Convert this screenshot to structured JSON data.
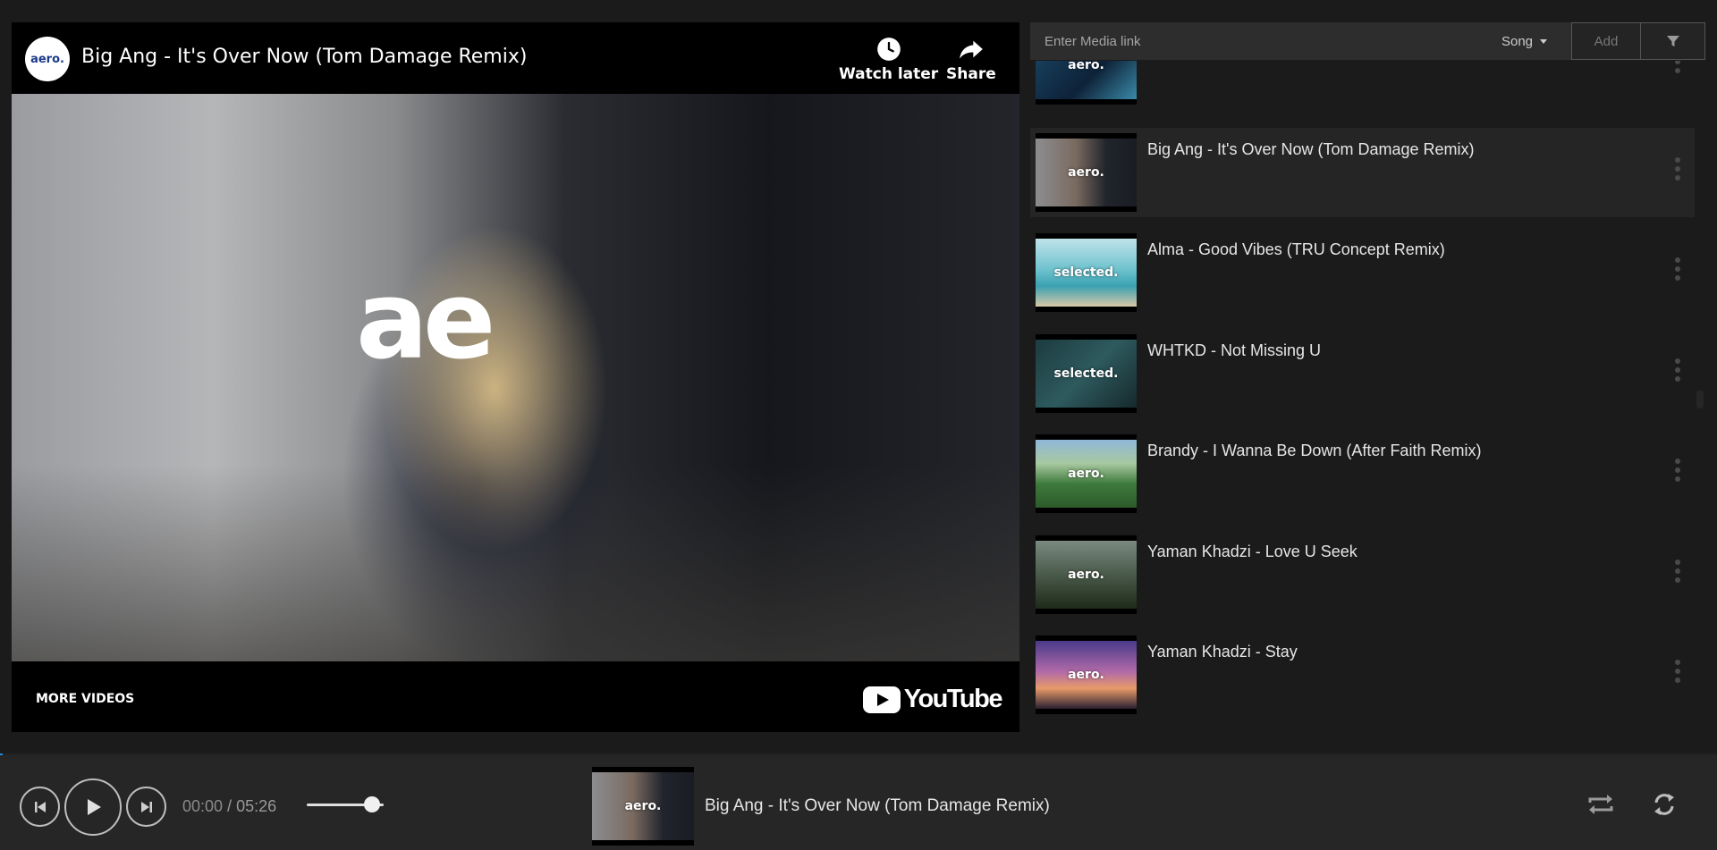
{
  "video": {
    "title": "Big Ang - It's Over Now (Tom Damage Remix)",
    "channel_logo_text": "aero.",
    "watermark_text": "ae",
    "actions": {
      "watch_later": "Watch later",
      "share": "Share"
    },
    "more_videos": "MORE VIDEOS",
    "youtube_label": "YouTube"
  },
  "media_bar": {
    "placeholder": "Enter Media link",
    "type_selected": "Song",
    "add_label": "Add"
  },
  "playlist": [
    {
      "title": "",
      "thumb_label": "aero.",
      "thumb_bg": "linear-gradient(135deg,#1a4a6a,#0e2238 60%,#3a8aa8)",
      "active": false
    },
    {
      "title": "Big Ang - It's Over Now (Tom Damage Remix)",
      "thumb_label": "aero.",
      "thumb_bg": "linear-gradient(90deg,#8c8d90 0%,#7a6a60 40%,#20242c 70%,#1a1c22 100%)",
      "active": true
    },
    {
      "title": "Alma - Good Vibes (TRU Concept Remix)",
      "thumb_label": "selected.",
      "thumb_bg": "linear-gradient(180deg,#bfe3ea 0%,#6fc3cf 45%,#3aa1b0 70%,#d9c8a8 100%)",
      "active": false
    },
    {
      "title": "WHTKD - Not Missing U",
      "thumb_label": "selected.",
      "thumb_bg": "linear-gradient(135deg,#1c3c40,#2e5a5e 50%,#16292c)",
      "active": false
    },
    {
      "title": "Brandy - I Wanna Be Down (After Faith Remix)",
      "thumb_label": "aero.",
      "thumb_bg": "linear-gradient(180deg,#8fb8d8 0%,#a8c8a0 35%,#3e7a3c 65%,#2c5a2a 100%)",
      "active": false
    },
    {
      "title": "Yaman Khadzi - Love U Seek",
      "thumb_label": "aero.",
      "thumb_bg": "linear-gradient(180deg,#7a8a80 0%,#4a5a4a 50%,#1e2a1a 100%)",
      "active": false
    },
    {
      "title": "Yaman Khadzi - Stay",
      "thumb_label": "aero.",
      "thumb_bg": "linear-gradient(180deg,#4a3a8a 0%,#b06aa8 45%,#e89a6a 70%,#2a2030 100%)",
      "active": false
    }
  ],
  "player": {
    "current_time": "00:00",
    "separator": " / ",
    "total_time": "05:26",
    "volume_fraction": 0.85,
    "now_playing_title": "Big Ang - It's Over Now (Tom Damage Remix)",
    "now_playing_thumb_label": "aero."
  },
  "icons": {
    "prev": "skip-previous-icon",
    "play": "play-icon",
    "next": "skip-next-icon",
    "repeat": "repeat-icon",
    "shuffle": "refresh-icon",
    "filter": "filter-icon",
    "watch_later": "clock-icon",
    "share": "share-arrow-icon"
  }
}
